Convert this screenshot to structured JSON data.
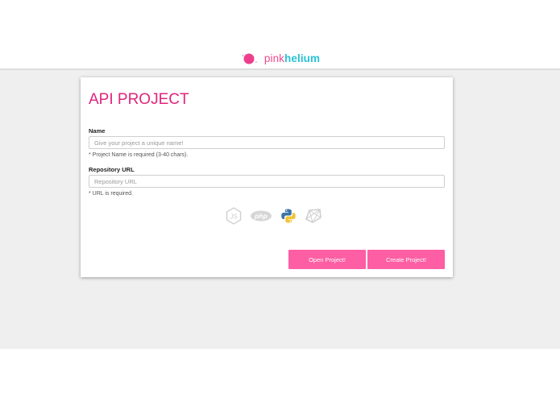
{
  "brand": {
    "name_part1": "pink",
    "name_part2": "helium"
  },
  "form": {
    "title": "API PROJECT",
    "name_label": "Name",
    "name_placeholder": "Give your project a unique name!",
    "name_value": "",
    "name_help": "* Project Name is required (3-40 chars).",
    "repo_label": "Repository URL",
    "repo_placeholder": "Repository URL",
    "repo_value": "",
    "repo_help": "* URL is required.",
    "languages": [
      {
        "icon": "nodejs-icon",
        "state": "inactive"
      },
      {
        "icon": "php-icon",
        "label": "php",
        "state": "inactive"
      },
      {
        "icon": "python-icon",
        "state": "active"
      },
      {
        "icon": "ruby-icon",
        "state": "inactive"
      }
    ],
    "open_button": "Open Project!",
    "create_button": "Create Project!"
  },
  "colors": {
    "accent": "#e0247c",
    "button": "#fd5ea4",
    "brand_pink": "#ee4b8f",
    "brand_cyan": "#29c2d6",
    "background": "#efefef"
  }
}
